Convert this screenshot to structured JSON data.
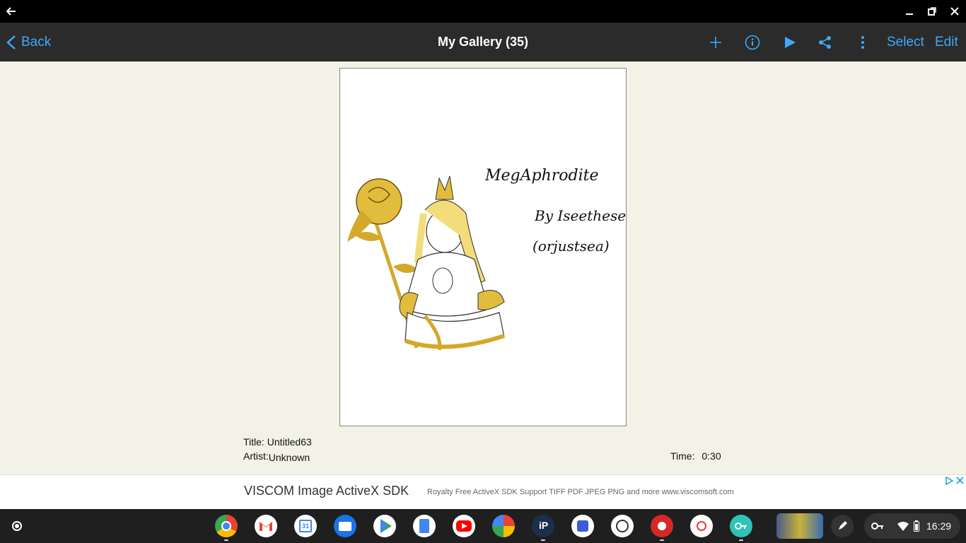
{
  "window": {
    "back_icon": "arrow-left-icon",
    "minimize_icon": "minimize-icon",
    "restore_icon": "restore-icon",
    "close_icon": "close-icon"
  },
  "navbar": {
    "back_label": "Back",
    "title": "My Gallery (35)",
    "icons": [
      "plus-icon",
      "info-icon",
      "play-icon",
      "share-icon",
      "more-vert-icon"
    ],
    "select_label": "Select",
    "edit_label": "Edit",
    "accent_color": "#3fa9f5"
  },
  "artwork": {
    "heading": "MegAphrodite",
    "credit_line1": "By Iseethesea",
    "credit_line2": "(orjustsea)"
  },
  "details": {
    "title_label": "Title:",
    "title_value": "Untitled63",
    "artist_label": "Artist:",
    "artist_value": "Unknown",
    "time_label": "Time:",
    "time_value": "0:30"
  },
  "ad": {
    "title": "VISCOM Image ActiveX SDK",
    "description": "Royalty Free ActiveX SDK Support TIFF PDF JPEG PNG and more www.viscomsoft.com"
  },
  "shelf": {
    "launcher_icon": "launcher-icon",
    "apps": [
      "chrome-icon",
      "gmail-icon",
      "calendar-icon",
      "files-icon",
      "play-store-icon",
      "docs-icon",
      "youtube-icon",
      "photos-icon",
      "ibis-paint-icon",
      "app-icon",
      "soccer-app-icon",
      "red-app-icon",
      "app-icon-2",
      "key-app-icon",
      "game-thumbnail-icon"
    ],
    "stylus_icon": "stylus-icon",
    "clock": "16:29"
  }
}
